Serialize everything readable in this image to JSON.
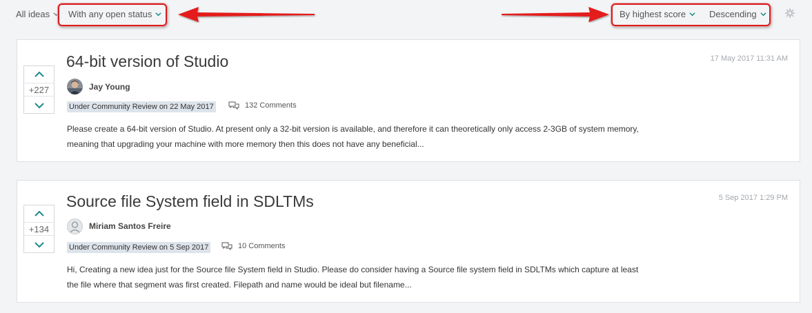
{
  "filters": {
    "all_ideas": "All ideas",
    "status": "With any open status",
    "sort_by": "By highest score",
    "order": "Descending"
  },
  "ideas": [
    {
      "score": "+227",
      "title": "64-bit version of Studio",
      "author": "Jay Young",
      "status": "Under Community Review on 22 May 2017",
      "comments": "132 Comments",
      "date": "17 May 2017 11:31 AM",
      "description_line1": "Please create a 64-bit version of Studio. At present only a 32-bit version is available, and therefore it can theoretically only access 2-3GB of system memory,",
      "description_line2": "meaning that upgrading your machine with more memory then this does not have any beneficial..."
    },
    {
      "score": "+134",
      "title": "Source file System field in SDLTMs",
      "author": "Miriam Santos Freire",
      "status": "Under Community Review on 5 Sep 2017",
      "comments": "10 Comments",
      "date": "5 Sep 2017 1:29 PM",
      "description_line1": "Hi, Creating a new idea just for the Source file System field in Studio. Please do consider having a Source file system field in SDLTMs which capture at least",
      "description_line2": "the file where that segment was first created. Filepath and name would be ideal but filename..."
    }
  ],
  "colors": {
    "accent": "#1a8a8a",
    "highlight_box": "#d91c1c",
    "status_badge_bg": "#dde3ea"
  }
}
